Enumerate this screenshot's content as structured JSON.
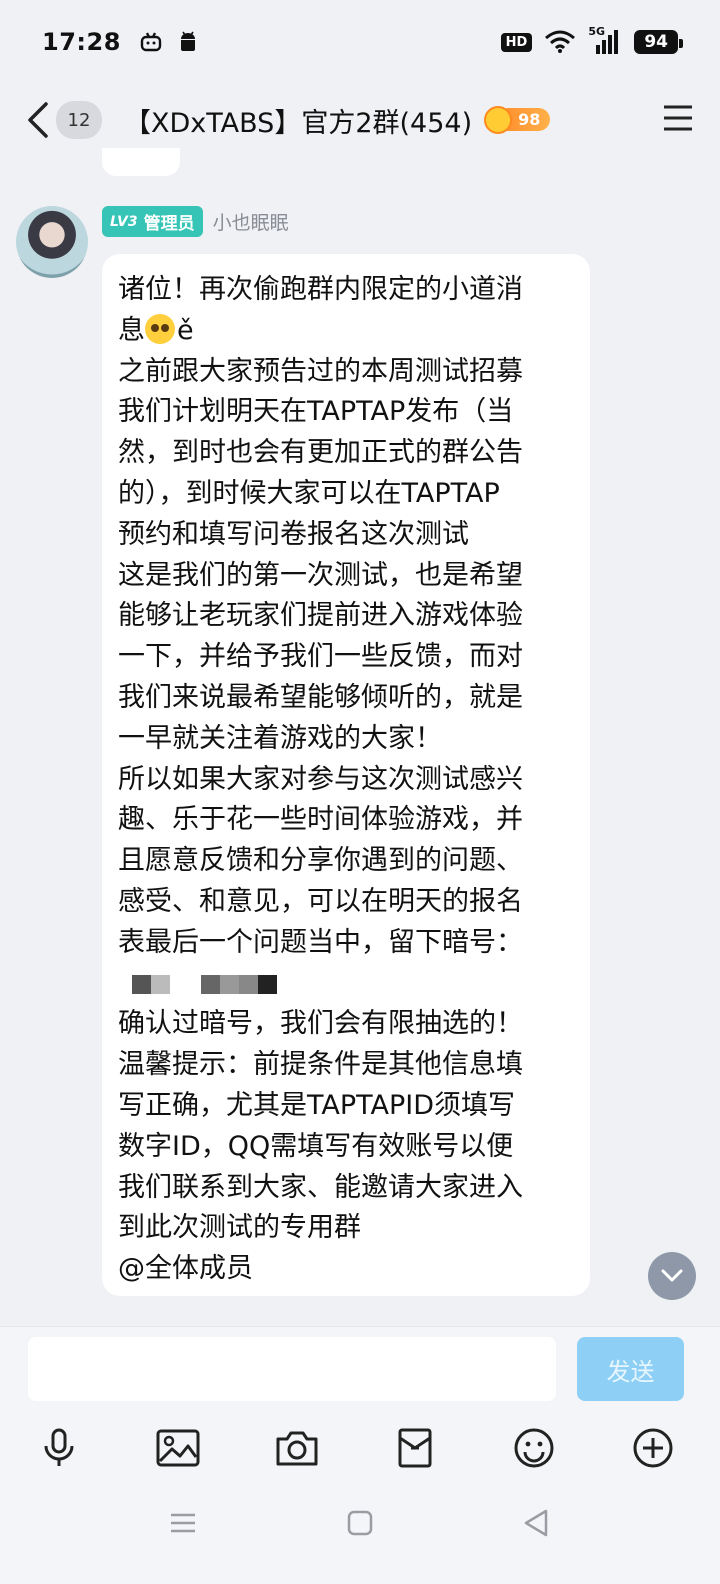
{
  "status_bar": {
    "time": "17:28",
    "hd": "HD",
    "network": "5G",
    "battery": "94"
  },
  "nav": {
    "unread_count": "12",
    "group_title": "【XDxTABS】官方2群(454)",
    "fire_level": "98"
  },
  "message": {
    "level_label": "LV3",
    "role_label": "管理员",
    "sender_name": "小也眠眠",
    "lines": [
      "诸位！再次偷跑群内限定的小道消",
      "息",
      "之前跟大家预告过的本周测试招募",
      "我们计划明天在TAPTAP发布（当",
      "然，到时也会有更加正式的群公告",
      "的），到时候大家可以在TAPTAP",
      "预约和填写问卷报名这次测试",
      "这是我们的第一次测试，也是希望",
      "能够让老玩家们提前进入游戏体验",
      "一下，并给予我们一些反馈，而对",
      "我们来说最希望能够倾听的，就是",
      "一早就关注着游戏的大家！",
      "所以如果大家对参与这次测试感兴",
      "趣、乐于花一些时间体验游戏，并",
      "且愿意反馈和分享你遇到的问题、",
      "感受、和意见，可以在明天的报名",
      "表最后一个问题当中，留下暗号：",
      "",
      "确认过暗号，我们会有限抽选的！",
      "温馨提示：前提条件是其他信息填",
      "写正确，尤其是TAPTAPID须填写",
      "数字ID，QQ需填写有效账号以便",
      "我们联系到大家、能邀请大家进入",
      "到此次测试的专用群",
      "@全体成员"
    ],
    "emoji_suffix": "ě"
  },
  "composer": {
    "input_value": "",
    "send_label": "发送"
  },
  "colors": {
    "accent_send": "#8ed0f5",
    "role_badge": "#35c4b6",
    "fire_badge": "#ff8f2e"
  },
  "icons": {
    "toolbar": [
      "microphone-icon",
      "image-icon",
      "camera-icon",
      "red-packet-icon",
      "emoji-icon",
      "plus-icon"
    ],
    "system_nav": [
      "menu-icon",
      "home-icon",
      "back-icon"
    ]
  }
}
